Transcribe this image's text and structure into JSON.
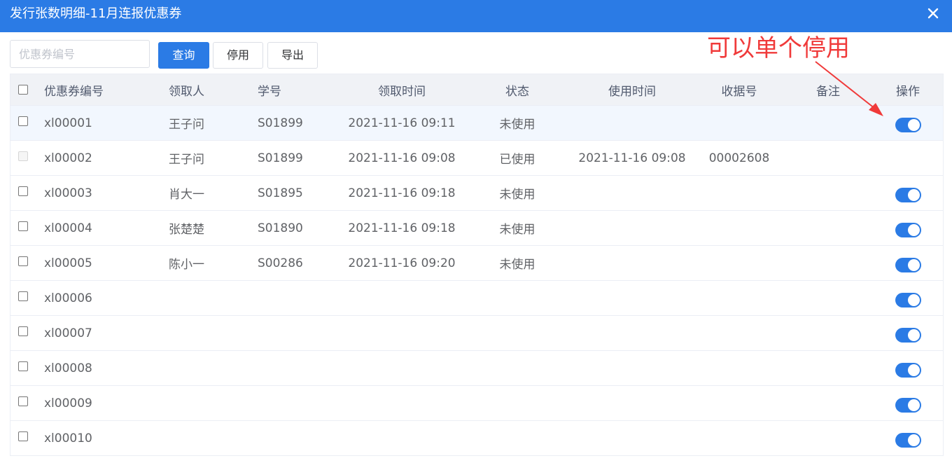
{
  "dialog": {
    "title": "发行张数明细-11月连报优惠券"
  },
  "toolbar": {
    "search_placeholder": "优惠券编号",
    "search_value": "",
    "query_label": "查询",
    "disable_label": "停用",
    "export_label": "导出"
  },
  "annotation": {
    "text": "可以单个停用",
    "color": "#f03a3a"
  },
  "colors": {
    "accent": "#2b7be5",
    "header_bg": "#f0f2f6",
    "row_highlight": "#f2f7fe"
  },
  "table": {
    "headers": {
      "code": "优惠券编号",
      "person": "领取人",
      "student_id": "学号",
      "get_time": "领取时间",
      "status": "状态",
      "use_time": "使用时间",
      "receipt": "收据号",
      "remark": "备注",
      "operation": "操作"
    },
    "rows": [
      {
        "code": "xl00001",
        "person": "王子问",
        "student_id": "S01899",
        "get_time": "2021-11-16 09:11",
        "status": "未使用",
        "use_time": "",
        "receipt": "",
        "remark": "",
        "toggle_on": true,
        "checkbox_disabled": false
      },
      {
        "code": "xl00002",
        "person": "王子问",
        "student_id": "S01899",
        "get_time": "2021-11-16 09:08",
        "status": "已使用",
        "use_time": "2021-11-16 09:08",
        "receipt": "00002608",
        "remark": "",
        "toggle_on": null,
        "checkbox_disabled": true
      },
      {
        "code": "xl00003",
        "person": "肖大一",
        "student_id": "S01895",
        "get_time": "2021-11-16 09:18",
        "status": "未使用",
        "use_time": "",
        "receipt": "",
        "remark": "",
        "toggle_on": true,
        "checkbox_disabled": false
      },
      {
        "code": "xl00004",
        "person": "张楚楚",
        "student_id": "S01890",
        "get_time": "2021-11-16 09:18",
        "status": "未使用",
        "use_time": "",
        "receipt": "",
        "remark": "",
        "toggle_on": true,
        "checkbox_disabled": false
      },
      {
        "code": "xl00005",
        "person": "陈小一",
        "student_id": "S00286",
        "get_time": "2021-11-16 09:20",
        "status": "未使用",
        "use_time": "",
        "receipt": "",
        "remark": "",
        "toggle_on": true,
        "checkbox_disabled": false
      },
      {
        "code": "xl00006",
        "person": "",
        "student_id": "",
        "get_time": "",
        "status": "",
        "use_time": "",
        "receipt": "",
        "remark": "",
        "toggle_on": true,
        "checkbox_disabled": false
      },
      {
        "code": "xl00007",
        "person": "",
        "student_id": "",
        "get_time": "",
        "status": "",
        "use_time": "",
        "receipt": "",
        "remark": "",
        "toggle_on": true,
        "checkbox_disabled": false
      },
      {
        "code": "xl00008",
        "person": "",
        "student_id": "",
        "get_time": "",
        "status": "",
        "use_time": "",
        "receipt": "",
        "remark": "",
        "toggle_on": true,
        "checkbox_disabled": false
      },
      {
        "code": "xl00009",
        "person": "",
        "student_id": "",
        "get_time": "",
        "status": "",
        "use_time": "",
        "receipt": "",
        "remark": "",
        "toggle_on": true,
        "checkbox_disabled": false
      },
      {
        "code": "xl00010",
        "person": "",
        "student_id": "",
        "get_time": "",
        "status": "",
        "use_time": "",
        "receipt": "",
        "remark": "",
        "toggle_on": true,
        "checkbox_disabled": false
      }
    ]
  }
}
